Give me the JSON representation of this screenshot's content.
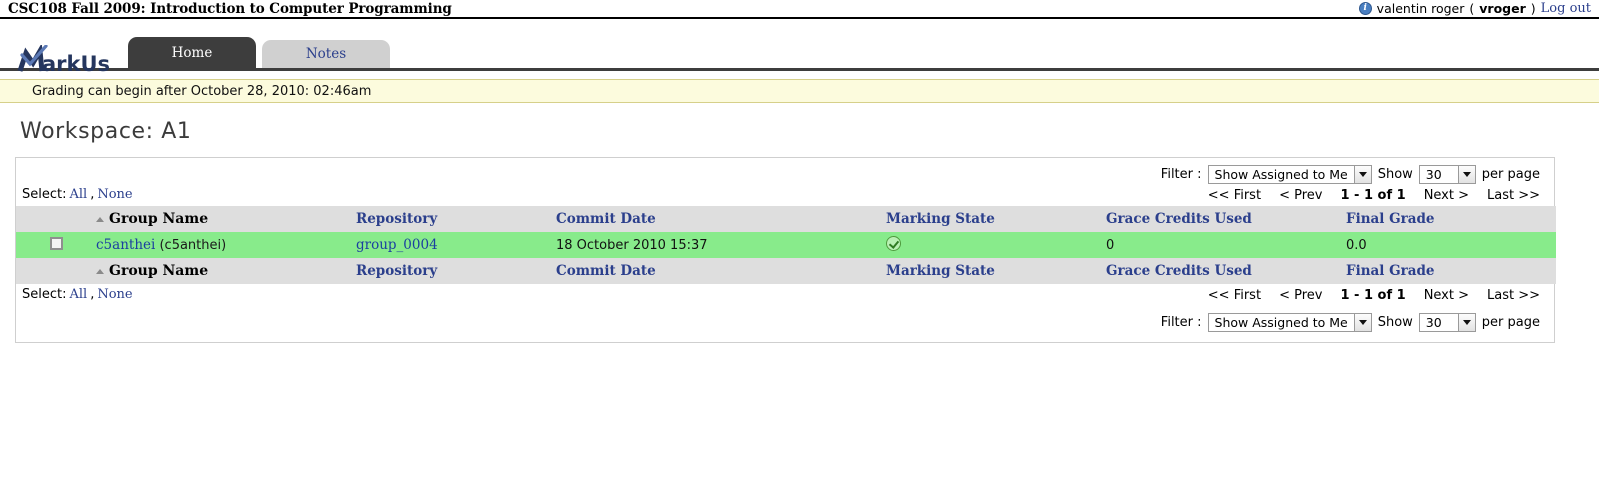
{
  "course": {
    "title": "CSC108 Fall 2009: Introduction to Computer Programming"
  },
  "user": {
    "icon": "info-icon",
    "display_name": "valentin roger",
    "open_paren": "(",
    "login": "vroger",
    "close_paren": ")",
    "logout_label": "Log out"
  },
  "brand": {
    "name": "MarkUs"
  },
  "tabs": [
    {
      "label": "Home",
      "active": true
    },
    {
      "label": "Notes",
      "active": false
    }
  ],
  "notice": {
    "text": "Grading can begin after October 28, 2010: 02:46am"
  },
  "page": {
    "title": "Workspace: A1"
  },
  "controls": {
    "filter_label": "Filter :",
    "filter_value": "Show Assigned to Me",
    "show_label": "Show",
    "per_page_value": "30",
    "per_page_label": "per page"
  },
  "pager": {
    "first": "<< First",
    "prev": "< Prev",
    "count": "1 - 1 of 1",
    "next": "Next >",
    "last": "Last >>"
  },
  "select_row": {
    "label": "Select:",
    "all": "All",
    "comma": ",",
    "none": "None"
  },
  "table": {
    "columns": [
      {
        "key": "checkbox",
        "label": ""
      },
      {
        "key": "group_name",
        "label": "Group Name",
        "sorted": true
      },
      {
        "key": "repository",
        "label": "Repository"
      },
      {
        "key": "commit_date",
        "label": "Commit Date"
      },
      {
        "key": "marking_state",
        "label": "Marking State"
      },
      {
        "key": "grace_credits",
        "label": "Grace Credits Used"
      },
      {
        "key": "final_grade",
        "label": "Final Grade"
      }
    ],
    "rows": [
      {
        "checked": false,
        "group_link": "c5anthei",
        "group_alias": "(c5anthei)",
        "repository": "group_0004",
        "commit_date": "18 October 2010 15:37",
        "marking_state_icon": "green-check-icon",
        "grace_credits": "0",
        "final_grade": "0.0"
      }
    ]
  },
  "colors": {
    "row_highlight": "#88eb8b",
    "header_grey": "#dedede",
    "notice_yellow": "#fcfbdd",
    "link_blue": "#2b3f8c",
    "tab_active": "#3d3d3d"
  }
}
